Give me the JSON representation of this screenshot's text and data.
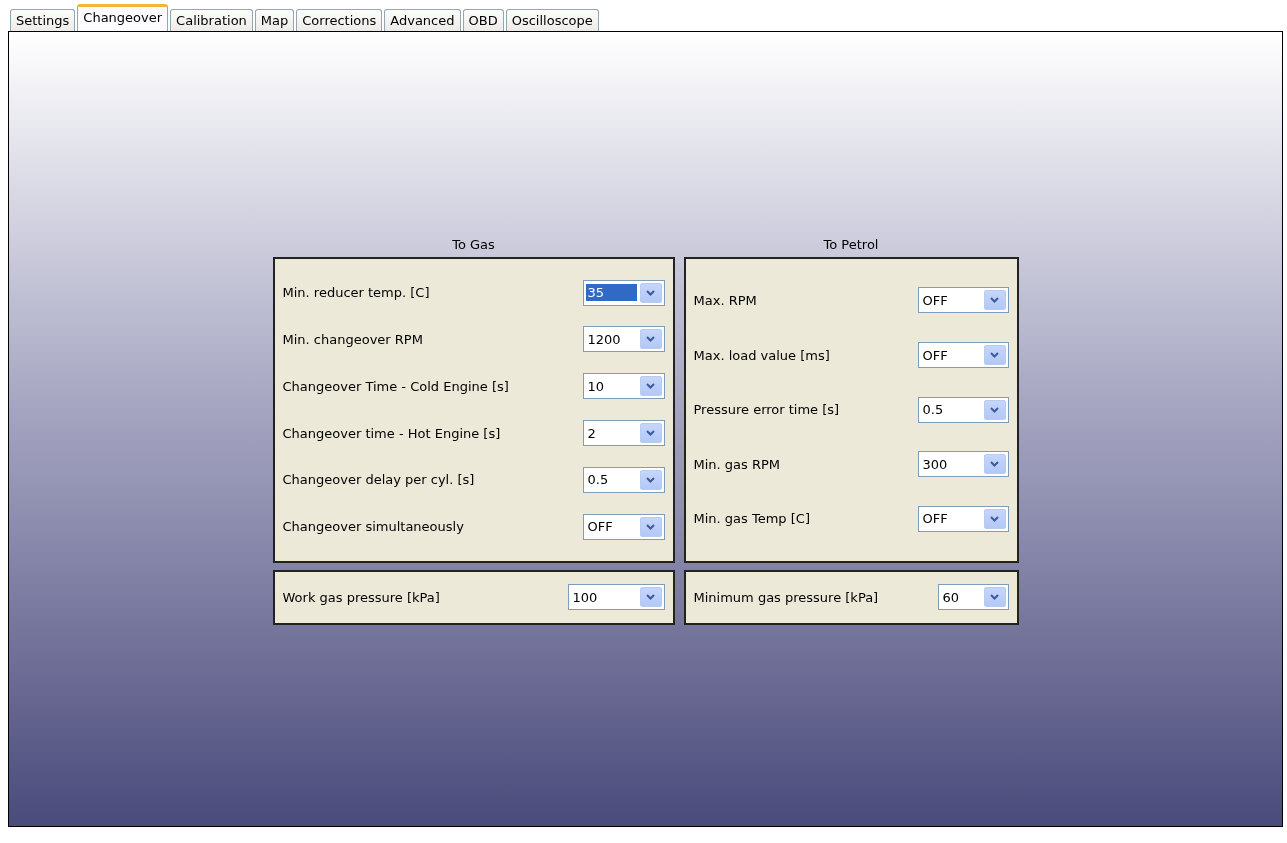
{
  "tabs": [
    {
      "label": "Settings",
      "selected": false
    },
    {
      "label": "Changeover",
      "selected": true
    },
    {
      "label": "Calibration",
      "selected": false
    },
    {
      "label": "Map",
      "selected": false
    },
    {
      "label": "Corrections",
      "selected": false
    },
    {
      "label": "Advanced",
      "selected": false
    },
    {
      "label": "OBD",
      "selected": false
    },
    {
      "label": "Oscilloscope",
      "selected": false
    }
  ],
  "groups": [
    {
      "title": "To Gas",
      "fields": [
        {
          "label": "Min. reducer temp. [C]",
          "value": "35",
          "highlighted": true
        },
        {
          "label": "Min. changeover RPM",
          "value": "1200",
          "highlighted": false
        },
        {
          "label": "Changeover Time - Cold Engine [s]",
          "value": "10",
          "highlighted": false
        },
        {
          "label": "Changeover time - Hot Engine [s]",
          "value": "2",
          "highlighted": false
        },
        {
          "label": "Changeover delay per cyl. [s]",
          "value": "0.5",
          "highlighted": false
        },
        {
          "label": "Changeover simultaneously",
          "value": "OFF",
          "highlighted": false
        }
      ],
      "pressure": {
        "label": "Work gas pressure [kPa]",
        "value": "100",
        "highlighted": false
      }
    },
    {
      "title": "To Petrol",
      "fields": [
        {
          "label": "Max. RPM",
          "value": "OFF",
          "highlighted": false
        },
        {
          "label": "Max. load value [ms]",
          "value": "OFF",
          "highlighted": false
        },
        {
          "label": "Pressure error time [s]",
          "value": "0.5",
          "highlighted": false
        },
        {
          "label": "Min. gas RPM",
          "value": "300",
          "highlighted": false
        },
        {
          "label": "Min. gas Temp [C]",
          "value": "OFF",
          "highlighted": false
        }
      ],
      "pressure": {
        "label": "Minimum gas pressure [kPa]",
        "value": "60",
        "highlighted": false
      }
    }
  ]
}
